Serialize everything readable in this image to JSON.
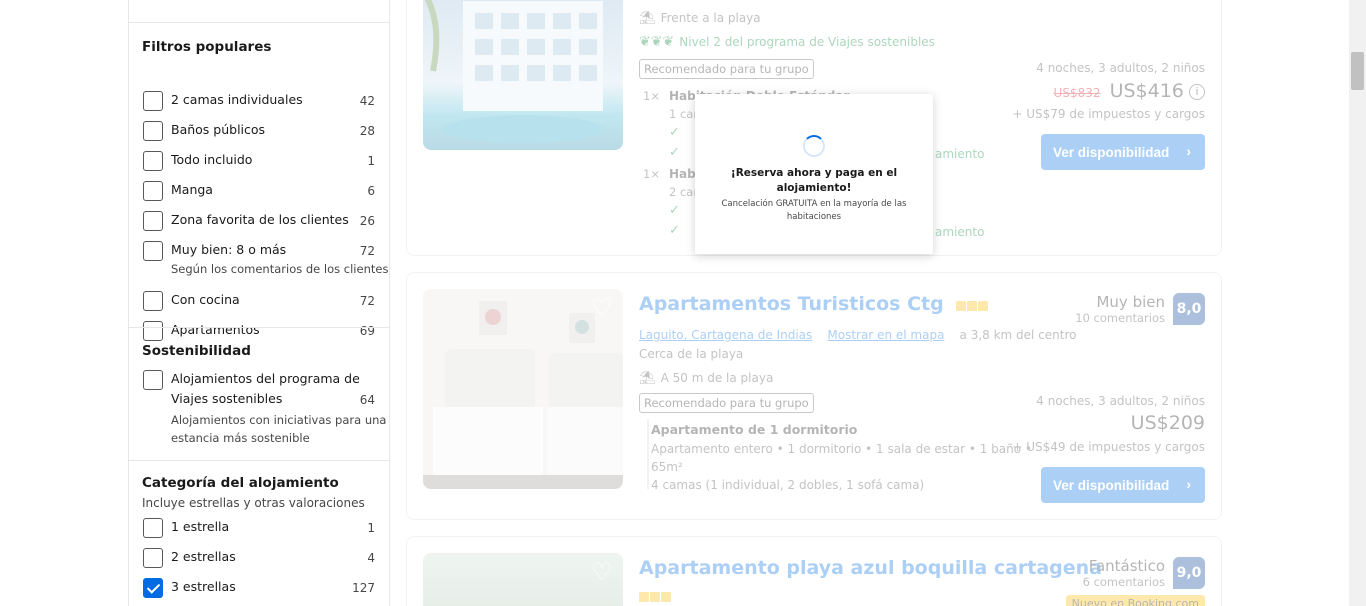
{
  "sidebar": {
    "popular": {
      "title": "Filtros populares",
      "items": [
        {
          "label": "2 camas individuales",
          "count": "42"
        },
        {
          "label": "Baños públicos",
          "count": "28"
        },
        {
          "label": "Todo incluido",
          "count": "1"
        },
        {
          "label": "Manga",
          "count": "6"
        },
        {
          "label": "Zona favorita de los clientes",
          "count": "26"
        },
        {
          "label": "Muy bien: 8 o más",
          "count": "72",
          "note": "Según los comentarios de los clientes"
        },
        {
          "label": "Con cocina",
          "count": "72"
        },
        {
          "label": "Apartamentos",
          "count": "69"
        }
      ]
    },
    "sustainability": {
      "title": "Sostenibilidad",
      "item_line1": "Alojamientos del programa de",
      "item_line2": "Viajes sostenibles",
      "count": "64",
      "note_line1": "Alojamientos con iniciativas para una",
      "note_line2": "estancia más sostenible"
    },
    "category": {
      "title": "Categoría del alojamiento",
      "subtitle": "Incluye estrellas y otras valoraciones",
      "items": [
        {
          "label": "1 estrella",
          "count": "1",
          "checked": false
        },
        {
          "label": "2 estrellas",
          "count": "4",
          "checked": false
        },
        {
          "label": "3 estrellas",
          "count": "127",
          "checked": true
        }
      ]
    }
  },
  "card1": {
    "beach": "Frente a la playa",
    "sustainable": "Nivel 2 del programa de Viajes sostenibles",
    "recommended": "Recomendado para tu grupo",
    "room1_qty": "1×",
    "room1_name": "Habitación Doble Estándar",
    "room1_line": "1 cam",
    "room1_side": "amiento",
    "room2_qty": "1×",
    "room2_name": "Habi",
    "room2_line": "2 cam",
    "room2_side": "amiento",
    "stay": "4 noches, 3 adultos, 2 niños",
    "old_price": "US$832",
    "price": "US$416",
    "taxes": "+ US$79 de impuestos y cargos",
    "button": "Ver disponibilidad"
  },
  "card2": {
    "name": "Apartamentos Turisticos Ctg",
    "location": "Laguito, Cartagena de Indias",
    "map_link": "Mostrar en el mapa",
    "distance": "a 3,8 km del centro",
    "near": "Cerca de la playa",
    "beach": "A 50 m de la playa",
    "recommended": "Recomendado para tu grupo",
    "unit_name": "Apartamento de 1 dormitorio",
    "unit_desc1": "Apartamento entero • 1 dormitorio • 1 sala de estar • 1 baño •",
    "unit_desc2": "65m²",
    "beds": "4 camas (1 individual, 2 dobles, 1 sofá cama)",
    "score_word": "Muy bien",
    "score_count": "10 comentarios",
    "score": "8,0",
    "stay": "4 noches, 3 adultos, 2 niños",
    "price": "US$209",
    "taxes": "+ US$49 de impuestos y cargos",
    "button": "Ver disponibilidad"
  },
  "card3": {
    "name": "Apartamento playa azul boquilla cartagena",
    "score_word": "Fantástico",
    "score_count": "6 comentarios",
    "score": "9,0",
    "badge": "Nuevo en Booking.com"
  },
  "modal": {
    "title": "¡Reserva ahora y paga en el alojamiento!",
    "subtitle": "Cancelación GRATUITA en la mayoría de las habitaciones"
  },
  "icons": {
    "beach": "beach-umbrella-icon",
    "leaf": "leaf-icon",
    "check": "check-icon",
    "heart": "heart-icon",
    "info": "info-icon",
    "chevron": "chevron-right-icon"
  },
  "colors": {
    "primary": "#006ce4",
    "score_bg": "#003b95",
    "star": "#febb02",
    "sustain_green": "#008234"
  }
}
